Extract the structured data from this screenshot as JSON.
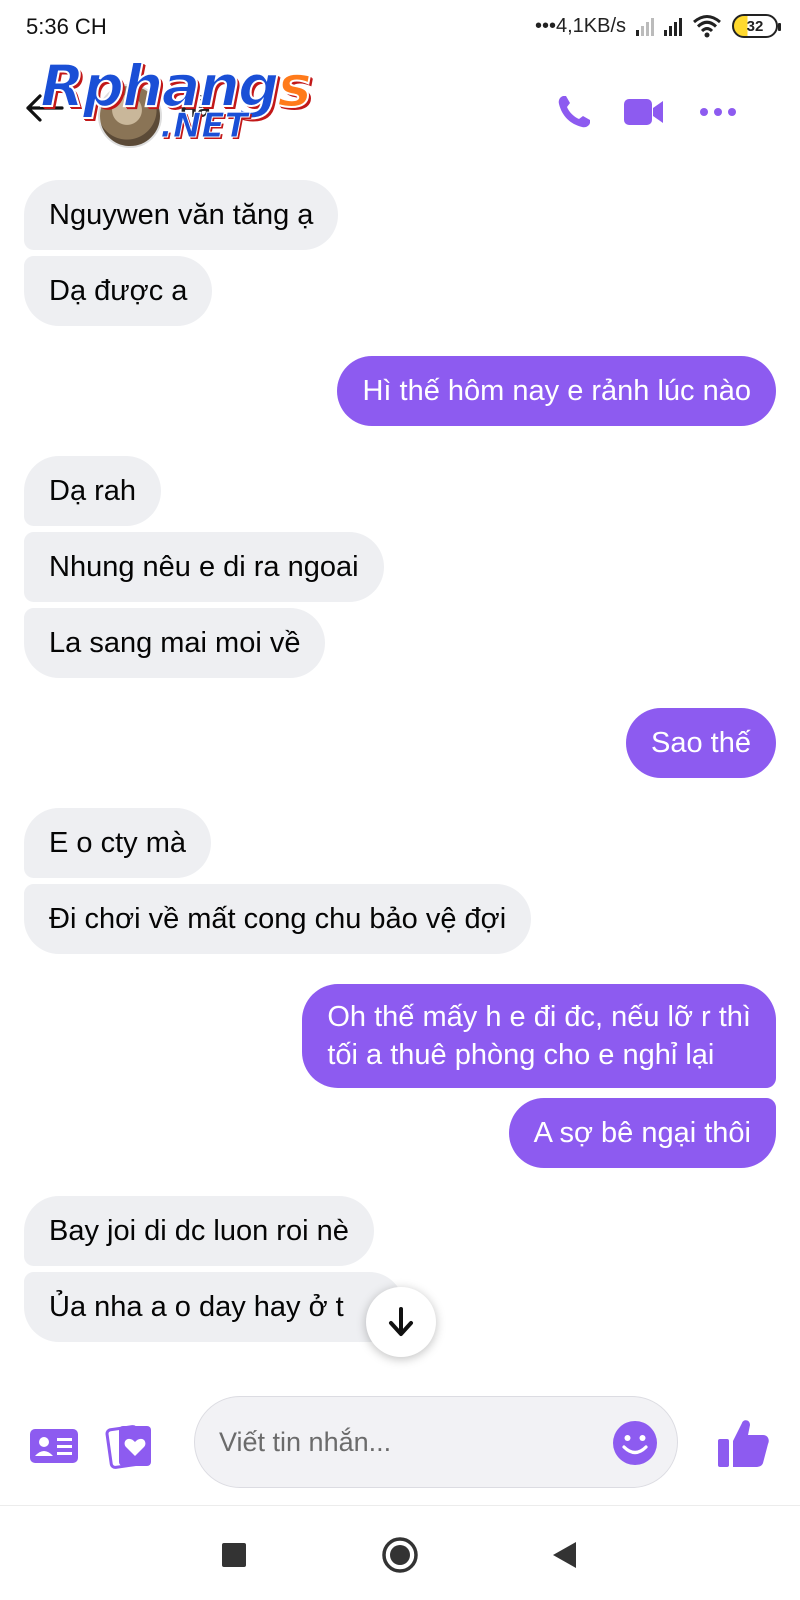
{
  "status_bar": {
    "time": "5:36 CH",
    "network_speed": "•••4,1KB/s",
    "battery": "32"
  },
  "header": {
    "contact_name": "Hằ",
    "logo_main": "Rphang",
    "logo_s": "s",
    "logo_sub": ".NET",
    "accent_color": "#8d5bf0",
    "icons": [
      "back-arrow-icon",
      "phone-icon",
      "video-camera-icon",
      "more-dots-icon"
    ]
  },
  "messages": [
    {
      "side": "in",
      "text": "Nguywen văn tăng ạ"
    },
    {
      "side": "in",
      "text": "Dạ được a"
    },
    {
      "side": "out",
      "text": "Hì thế hôm nay e rảnh lúc nào"
    },
    {
      "side": "in",
      "text": "Dạ rah"
    },
    {
      "side": "in",
      "text": "Nhung nêu e di ra ngoai"
    },
    {
      "side": "in",
      "text": "La sang mai moi về"
    },
    {
      "side": "out",
      "text": "Sao thế"
    },
    {
      "side": "in",
      "text": "E o cty mà"
    },
    {
      "side": "in",
      "text": "Đi chơi về mất cong chu bảo vệ đợi"
    },
    {
      "side": "out",
      "text": "Oh thế mấy h e đi đc, nếu lỡ r thì",
      "text2": "tối a thuê phòng cho e nghỉ lại"
    },
    {
      "side": "out",
      "text": "A sợ bê ngại thôi"
    },
    {
      "side": "in",
      "text": "Bay joi di dc luon roi nè"
    },
    {
      "side": "in",
      "text": "Ủa nha a o day hay ở t"
    }
  ],
  "composer": {
    "placeholder": "Viết tin nhắn..."
  },
  "colors": {
    "outgoing_bubble": "#8d5bf0",
    "incoming_bubble": "#eeeff2"
  }
}
